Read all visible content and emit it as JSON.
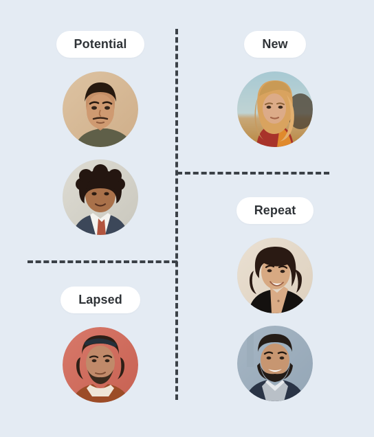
{
  "page": {
    "background_color": "#e4ebf3",
    "divider_color": "#3b4147",
    "pill_background": "#ffffff",
    "pill_text_color": "#2f3337",
    "layout": "four-quadrant segment matrix with dashed dividers"
  },
  "quadrants": [
    {
      "id": "potential",
      "label": "Potential",
      "position": "top-left",
      "avatar_count": 2,
      "avatars": [
        {
          "name": "avatar-potential-1",
          "description": "young man with short dark hair, neutral expression",
          "background_color": "#d8bb97",
          "skin_color": "#c98f66",
          "hair_color": "#2b1d14",
          "clothing_color": "#5b5a45"
        },
        {
          "name": "avatar-potential-2",
          "description": "man with curly hair in navy suit and patterned tie",
          "background_color": "#d3d2c9",
          "skin_color": "#a9714a",
          "hair_color": "#2a1a12",
          "clothing_color": "#3b4557"
        }
      ]
    },
    {
      "id": "new",
      "label": "New",
      "position": "top-right",
      "avatar_count": 1,
      "avatars": [
        {
          "name": "avatar-new-1",
          "description": "blonde woman outdoors in a wheat field at sunset",
          "background_color": "#a8c7cf",
          "skin_color": "#d9ab8b",
          "hair_color": "#d7a863",
          "clothing_color": "#a33426"
        }
      ]
    },
    {
      "id": "repeat",
      "label": "Repeat",
      "position": "bottom-right",
      "avatar_count": 2,
      "avatars": [
        {
          "name": "avatar-repeat-1",
          "description": "smiling woman with dark wavy hair in black top",
          "background_color": "#e3d8c9",
          "skin_color": "#d7a982",
          "hair_color": "#2c1b14",
          "clothing_color": "#15120f"
        },
        {
          "name": "avatar-repeat-2",
          "description": "smiling bearded man in navy jacket and grey sweater",
          "background_color": "#9fb0c0",
          "skin_color": "#c79671",
          "hair_color": "#241c17",
          "clothing_color": "#2a3446"
        }
      ]
    },
    {
      "id": "lapsed",
      "label": "Lapsed",
      "position": "bottom-left",
      "avatar_count": 1,
      "avatars": [
        {
          "name": "avatar-lapsed-1",
          "description": "bearded man with sunglasses on head, rust sweater, red background",
          "background_color": "#d06e5c",
          "skin_color": "#c08a6a",
          "hair_color": "#2e1f16",
          "clothing_color": "#9c4c27"
        }
      ]
    }
  ]
}
